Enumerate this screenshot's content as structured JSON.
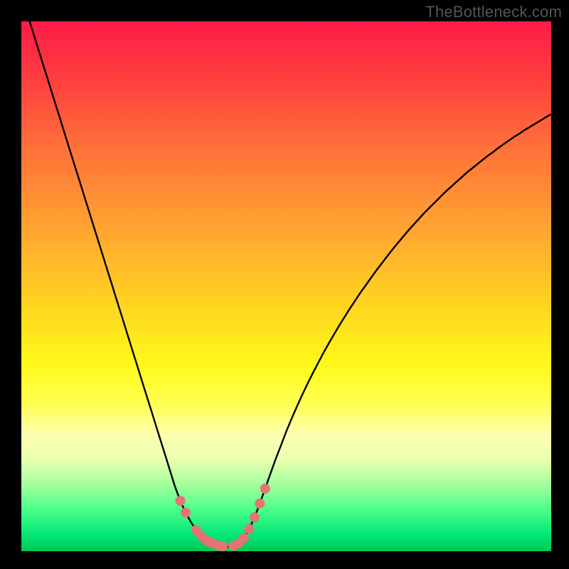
{
  "branding": {
    "site": "TheBottleneck.com"
  },
  "colors": {
    "curve": "#000000",
    "marker": "#e57373",
    "gradient_top": "#ff1a4a",
    "gradient_bottom": "#00c853"
  },
  "chart_data": {
    "type": "line",
    "title": "",
    "xlabel": "",
    "ylabel": "",
    "xlim": [
      0,
      100
    ],
    "ylim": [
      0,
      100
    ],
    "x": [
      0,
      1,
      2,
      3,
      4,
      5,
      6,
      7,
      8,
      9,
      10,
      11,
      12,
      13,
      14,
      15,
      16,
      17,
      18,
      19,
      20,
      21,
      22,
      23,
      24,
      25,
      26,
      27,
      28,
      29,
      30,
      31,
      32,
      33,
      34,
      35,
      36,
      37,
      38,
      39,
      40,
      41,
      42,
      43,
      44,
      45,
      46,
      47,
      48,
      49,
      50,
      51,
      52,
      53,
      54,
      55,
      56,
      57,
      58,
      59,
      60,
      61,
      62,
      63,
      64,
      65,
      66,
      67,
      68,
      69,
      70,
      71,
      72,
      73,
      74,
      75,
      76,
      77,
      78,
      79,
      80,
      81,
      82,
      83,
      84,
      85,
      86,
      87,
      88,
      89,
      90,
      91,
      92,
      93,
      94,
      95,
      96,
      97,
      98,
      99,
      100
    ],
    "values": [
      105,
      101.8,
      98.6,
      95.4,
      92.2,
      89.0,
      85.8,
      82.6,
      79.4,
      76.2,
      73.0,
      69.8,
      66.6,
      63.4,
      60.2,
      57.0,
      53.8,
      50.6,
      47.4,
      44.2,
      41.0,
      37.8,
      34.6,
      31.4,
      28.2,
      25.0,
      21.8,
      18.6,
      15.4,
      12.2,
      9.5,
      7.3,
      5.5,
      4.0,
      2.8,
      2.0,
      1.5,
      1.1,
      0.9,
      0.8,
      1.0,
      1.5,
      2.5,
      4.2,
      6.4,
      9.0,
      11.8,
      14.6,
      17.4,
      20.0,
      22.6,
      25.0,
      27.3,
      29.5,
      31.6,
      33.6,
      35.5,
      37.4,
      39.2,
      40.9,
      42.6,
      44.2,
      45.8,
      47.3,
      48.8,
      50.2,
      51.6,
      53.0,
      54.3,
      55.6,
      56.9,
      58.1,
      59.3,
      60.5,
      61.6,
      62.7,
      63.8,
      64.8,
      65.8,
      66.8,
      67.8,
      68.7,
      69.6,
      70.5,
      71.4,
      72.2,
      73.0,
      73.8,
      74.6,
      75.3,
      76.1,
      76.8,
      77.5,
      78.2,
      78.8,
      79.5,
      80.1,
      80.7,
      81.3,
      81.9,
      82.5
    ],
    "markers": [
      {
        "x": 30,
        "y": 9.5
      },
      {
        "x": 31,
        "y": 7.3
      },
      {
        "x": 33,
        "y": 4.0
      },
      {
        "x": 34,
        "y": 2.8
      },
      {
        "x": 35,
        "y": 2.0
      },
      {
        "x": 36,
        "y": 1.5
      },
      {
        "x": 37,
        "y": 1.1
      },
      {
        "x": 38,
        "y": 0.9
      },
      {
        "x": 40,
        "y": 1.0
      },
      {
        "x": 41,
        "y": 1.5
      },
      {
        "x": 42,
        "y": 2.5
      },
      {
        "x": 43,
        "y": 4.2
      },
      {
        "x": 44,
        "y": 6.4
      },
      {
        "x": 45,
        "y": 9.0
      },
      {
        "x": 46,
        "y": 11.8
      }
    ]
  }
}
